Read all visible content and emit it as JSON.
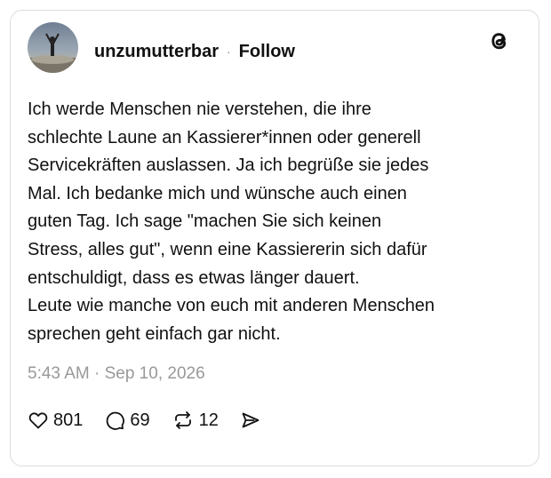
{
  "post": {
    "username": "unzumutterbar",
    "separator": "·",
    "follow_label": "Follow",
    "text": "Ich werde Menschen nie verstehen, die ihre\nschlechte Laune an Kassierer*innen oder generell\nServicekräften auslassen. Ja ich begrüße sie jedes\nMal. Ich bedanke mich und wünsche auch einen\nguten Tag. Ich sage \"machen Sie sich keinen\nStress, alles gut\", wenn eine Kassiererin sich dafür\nentschuldigt, dass es etwas länger dauert.\nLeute wie manche von euch mit anderen Menschen\nsprechen geht einfach gar nicht.",
    "timestamp": "5:43 AM · Sep 10, 2026"
  },
  "actions": {
    "likes": "801",
    "replies": "69",
    "reposts": "12"
  },
  "icons": {
    "logo": "threads-logo-icon",
    "like": "heart-icon",
    "reply": "comment-bubble-icon",
    "repost": "repost-icon",
    "share": "send-icon"
  }
}
